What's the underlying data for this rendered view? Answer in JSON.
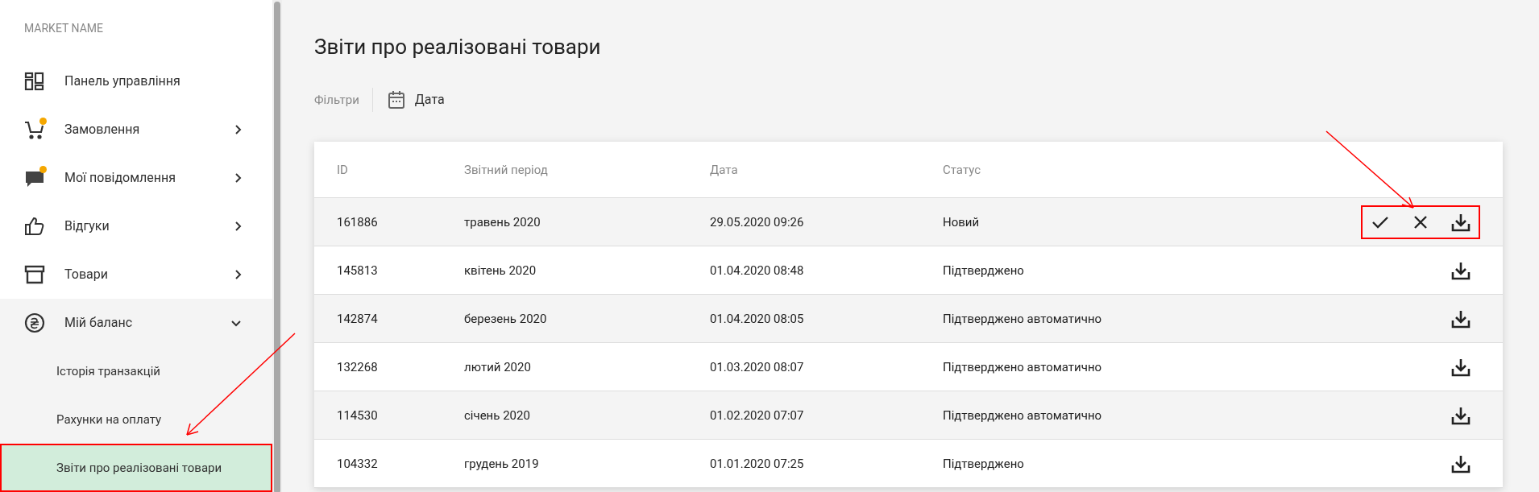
{
  "sidebar": {
    "market_name": "MARKET NAME",
    "items": [
      {
        "label": "Панель управління",
        "kind": "dashboard",
        "badge": false,
        "expandable": false,
        "selected": false,
        "highlighted": false
      },
      {
        "label": "Замовлення",
        "kind": "cart",
        "badge": true,
        "expandable": true,
        "expanded": false,
        "selected": false,
        "highlighted": false
      },
      {
        "label": "Мої повідомлення",
        "kind": "chat",
        "badge": true,
        "expandable": true,
        "expanded": false,
        "selected": false,
        "highlighted": false
      },
      {
        "label": "Відгуки",
        "kind": "thumb",
        "badge": false,
        "expandable": true,
        "expanded": false,
        "selected": false,
        "highlighted": false
      },
      {
        "label": "Товари",
        "kind": "box",
        "badge": false,
        "expandable": true,
        "expanded": false,
        "selected": false,
        "highlighted": false
      },
      {
        "label": "Мій баланс",
        "kind": "hryvnia",
        "badge": false,
        "expandable": true,
        "expanded": true,
        "selected": false,
        "highlighted": false,
        "children": [
          {
            "label": "Історія транзакцій",
            "selected": false,
            "highlighted": false
          },
          {
            "label": "Рахунки на оплату",
            "selected": false,
            "highlighted": false
          },
          {
            "label": "Звіти про реалізовані товари",
            "selected": true,
            "highlighted": true
          }
        ]
      }
    ]
  },
  "page": {
    "title": "Звіти про реалізовані товари",
    "filters_label": "Фільтри",
    "filter": "Дата"
  },
  "table": {
    "columns": [
      "ID",
      "Звітний період",
      "Дата",
      "Статус"
    ],
    "rows": [
      {
        "cells": [
          "161886",
          "травень 2020",
          "29.05.2020 09:26",
          "Новий"
        ],
        "actions": [
          {
            "kind": "confirm"
          },
          {
            "kind": "reject"
          },
          {
            "kind": "download"
          }
        ],
        "highlighted": true
      },
      {
        "cells": [
          "145813",
          "квітень 2020",
          "01.04.2020 08:48",
          "Підтверджено"
        ],
        "actions": [
          {
            "kind": "download"
          }
        ],
        "highlighted": false
      },
      {
        "cells": [
          "142874",
          "березень 2020",
          "01.04.2020 08:05",
          "Підтверджено автоматично"
        ],
        "actions": [
          {
            "kind": "download"
          }
        ],
        "highlighted": false
      },
      {
        "cells": [
          "132268",
          "лютий 2020",
          "01.03.2020 08:07",
          "Підтверджено автоматично"
        ],
        "actions": [
          {
            "kind": "download"
          }
        ],
        "highlighted": false
      },
      {
        "cells": [
          "114530",
          "січень 2020",
          "01.02.2020 07:07",
          "Підтверджено автоматично"
        ],
        "actions": [
          {
            "kind": "download"
          }
        ],
        "highlighted": false
      },
      {
        "cells": [
          "104332",
          "грудень 2019",
          "01.01.2020 07:25",
          "Підтверджено"
        ],
        "actions": [
          {
            "kind": "download"
          }
        ],
        "highlighted": false
      }
    ]
  }
}
